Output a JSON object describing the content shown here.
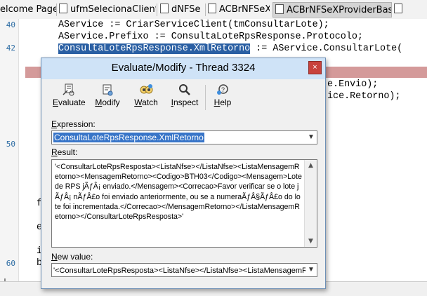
{
  "tabs": [
    {
      "label": "elcome Page",
      "icon": "page-icon"
    },
    {
      "label": "ufmSelecionaCliente",
      "icon": "form-icon"
    },
    {
      "label": "dNFSe",
      "icon": "datamodule-icon"
    },
    {
      "label": "ACBrNFSeX",
      "icon": "unit-icon"
    },
    {
      "label": "ACBrNFSeXProviderBase",
      "icon": "unit-icon"
    }
  ],
  "editor": {
    "line_numbers": [
      "40",
      "42",
      "50",
      "60"
    ],
    "lines": [
      "AService := CriarServiceClient(tmConsultarLote);",
      "AService.Prefixo := ConsultaLoteRpsResponse.Protocolo;"
    ],
    "line3_selected": "ConsultaLoteRpsResponse.XmlRetorno",
    "line3_rest": " := AService.ConsultarLote(",
    "right_fragments": [
      "e.Envio);",
      "ice.Retorno);"
    ],
    "left_fragments": [
      "f",
      "e",
      "i",
      "b"
    ]
  },
  "dialog": {
    "title": "Evaluate/Modify - Thread 3324",
    "close": "×",
    "toolbar": [
      {
        "label": "Evaluate",
        "underline": "E",
        "icon": "evaluate-icon"
      },
      {
        "label": "Modify",
        "underline": "M",
        "icon": "modify-icon"
      },
      {
        "label": "Watch",
        "underline": "W",
        "icon": "watch-icon"
      },
      {
        "label": "Inspect",
        "underline": "I",
        "icon": "inspect-icon"
      },
      {
        "label": "Help",
        "underline": "H",
        "icon": "help-icon"
      }
    ],
    "expression_label": "Expression:",
    "expression_value": "ConsultaLoteRpsResponse.XmlRetorno",
    "result_label": "Result:",
    "result_value": "'<ConsultarLoteRpsResposta><ListaNfse></ListaNfse><ListaMensagemRetorno><MensagemRetorno><Codigo>BTH03</Codigo><Mensagem>Lote de RPS jÃƒÂ¡ enviado.</Mensagem><Correcao>Favor verificar se o lote jÃƒÂ¡ nÃƒÂ£o foi enviado anteriormente, ou se a numeraÃƒÂ§ÃƒÂ£o do lote foi incrementada.</Correcao></MensagemRetorno></ListaMensagemRetorno></ConsultarLoteRpsResposta>'",
    "new_value_label": "New value:",
    "new_value": "'<ConsultarLoteRpsResposta><ListaNfse></ListaNfse><ListaMensagemR"
  }
}
